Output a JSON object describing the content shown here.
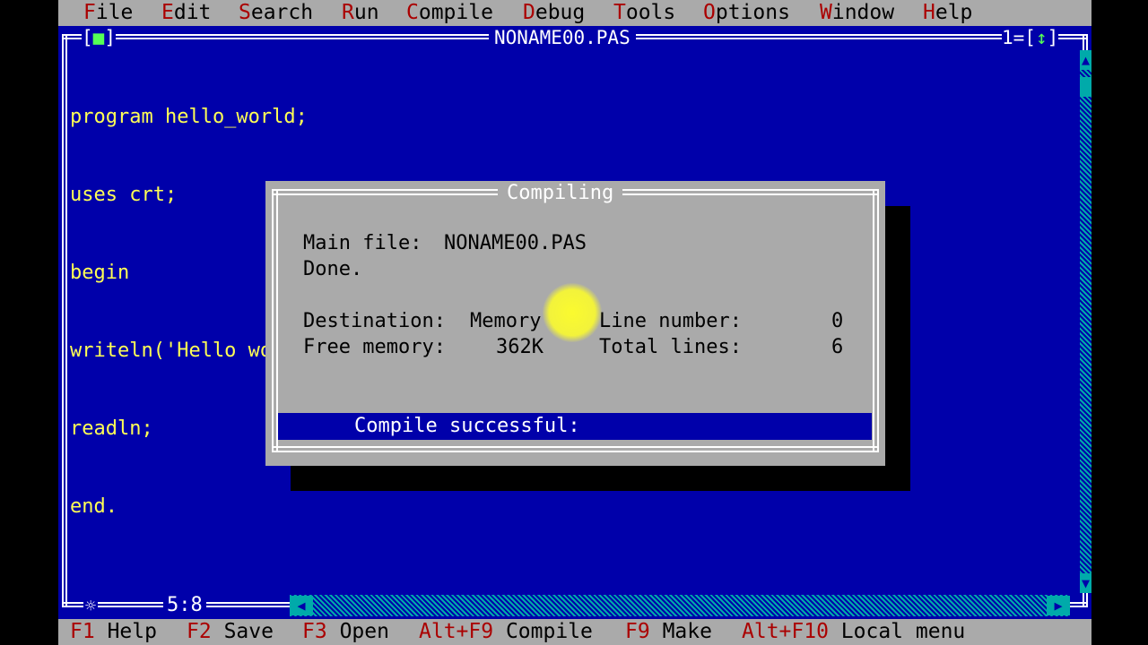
{
  "menu": {
    "items": [
      {
        "hot": "F",
        "rest": "ile"
      },
      {
        "hot": "E",
        "rest": "dit"
      },
      {
        "hot": "S",
        "rest": "earch"
      },
      {
        "hot": "R",
        "rest": "un"
      },
      {
        "hot": "C",
        "rest": "ompile"
      },
      {
        "hot": "D",
        "rest": "ebug"
      },
      {
        "hot": "T",
        "rest": "ools"
      },
      {
        "hot": "O",
        "rest": "ptions"
      },
      {
        "hot": "W",
        "rest": "indow"
      },
      {
        "hot": "H",
        "rest": "elp"
      }
    ]
  },
  "editor": {
    "title": "NONAME00.PAS",
    "close_box": "[",
    "close_mark": "■",
    "close_end": "]",
    "window_number": "1=[",
    "zoom_arrow": "↕",
    "zoom_end": "]",
    "lines": [
      "program hello_world;",
      "uses crt;",
      "begin",
      "writeln('Hello world');",
      "readln;",
      "end."
    ],
    "cursor_position": "5:8",
    "resize_icon": "☼"
  },
  "dialog": {
    "title": "Compiling",
    "main_file_label": "Main file:",
    "main_file_value": "NONAME00.PAS",
    "state": "Done.",
    "destination_label": "Destination:",
    "destination_value": "Memory",
    "free_memory_label": "Free memory:",
    "free_memory_value": "362K",
    "line_number_label": "Line number:",
    "line_number_value": "0",
    "total_lines_label": "Total lines:",
    "total_lines_value": "6",
    "status": "Compile successful:"
  },
  "statusbar": {
    "items": [
      {
        "key": "F1",
        "label": "Help"
      },
      {
        "key": "F2",
        "label": "Save"
      },
      {
        "key": "F3",
        "label": "Open"
      },
      {
        "key": "Alt+F9",
        "label": "Compile"
      },
      {
        "key": "F9",
        "label": "Make"
      },
      {
        "key": "Alt+F10",
        "label": "Local menu"
      }
    ]
  },
  "colors": {
    "desktop_blue": "#0000aa",
    "menu_gray": "#aaaaaa",
    "hotkey_red": "#aa0000",
    "code_yellow": "#ffff55",
    "cursor_orange": "#c25a00"
  }
}
